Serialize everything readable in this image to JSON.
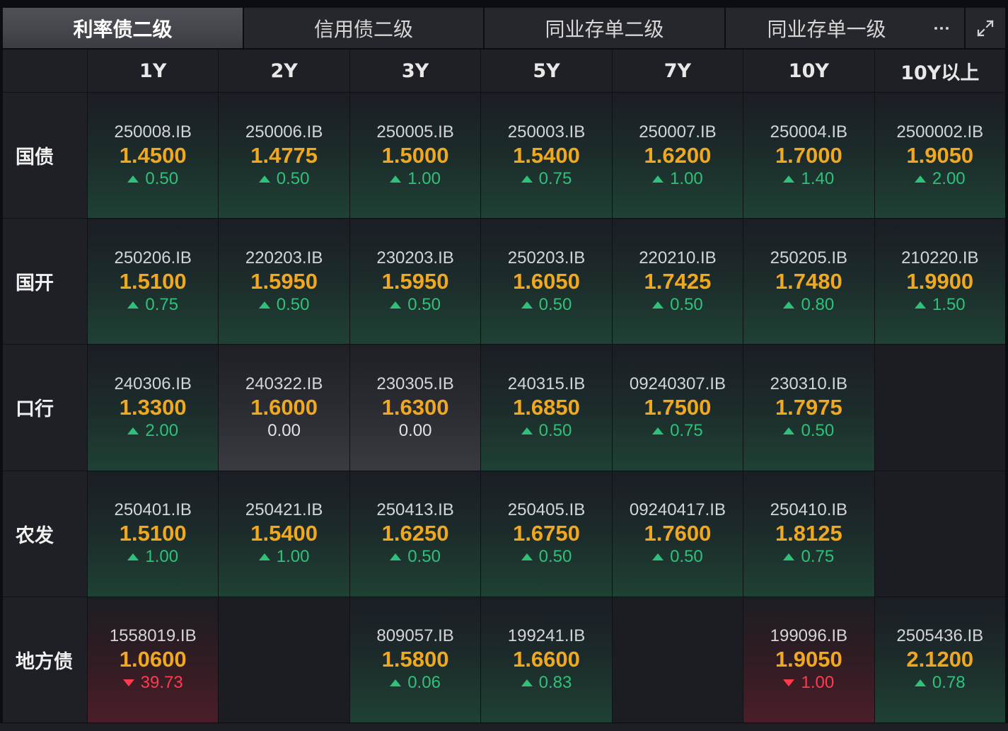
{
  "tabs": [
    {
      "label": "利率债二级",
      "active": true
    },
    {
      "label": "信用债二级",
      "active": false
    },
    {
      "label": "同业存单二级",
      "active": false
    },
    {
      "label": "同业存单一级",
      "active": false
    }
  ],
  "toolbar_icons": {
    "more": "more-icon",
    "expand": "expand-icon"
  },
  "columns": [
    "1Y",
    "2Y",
    "3Y",
    "5Y",
    "7Y",
    "10Y",
    "10Y以上"
  ],
  "rows": [
    {
      "label": "国债",
      "cells": [
        {
          "code": "250008.IB",
          "yield": "1.4500",
          "change": "0.50",
          "direction": "up"
        },
        {
          "code": "250006.IB",
          "yield": "1.4775",
          "change": "0.50",
          "direction": "up"
        },
        {
          "code": "250005.IB",
          "yield": "1.5000",
          "change": "1.00",
          "direction": "up"
        },
        {
          "code": "250003.IB",
          "yield": "1.5400",
          "change": "0.75",
          "direction": "up"
        },
        {
          "code": "250007.IB",
          "yield": "1.6200",
          "change": "1.00",
          "direction": "up"
        },
        {
          "code": "250004.IB",
          "yield": "1.7000",
          "change": "1.40",
          "direction": "up"
        },
        {
          "code": "2500002.IB",
          "yield": "1.9050",
          "change": "2.00",
          "direction": "up"
        }
      ]
    },
    {
      "label": "国开",
      "cells": [
        {
          "code": "250206.IB",
          "yield": "1.5100",
          "change": "0.75",
          "direction": "up"
        },
        {
          "code": "220203.IB",
          "yield": "1.5950",
          "change": "0.50",
          "direction": "up"
        },
        {
          "code": "230203.IB",
          "yield": "1.5950",
          "change": "0.50",
          "direction": "up"
        },
        {
          "code": "250203.IB",
          "yield": "1.6050",
          "change": "0.50",
          "direction": "up"
        },
        {
          "code": "220210.IB",
          "yield": "1.7425",
          "change": "0.50",
          "direction": "up"
        },
        {
          "code": "250205.IB",
          "yield": "1.7480",
          "change": "0.80",
          "direction": "up"
        },
        {
          "code": "210220.IB",
          "yield": "1.9900",
          "change": "1.50",
          "direction": "up"
        }
      ]
    },
    {
      "label": "口行",
      "cells": [
        {
          "code": "240306.IB",
          "yield": "1.3300",
          "change": "2.00",
          "direction": "up"
        },
        {
          "code": "240322.IB",
          "yield": "1.6000",
          "change": "0.00",
          "direction": "flat"
        },
        {
          "code": "230305.IB",
          "yield": "1.6300",
          "change": "0.00",
          "direction": "flat"
        },
        {
          "code": "240315.IB",
          "yield": "1.6850",
          "change": "0.50",
          "direction": "up"
        },
        {
          "code": "09240307.IB",
          "yield": "1.7500",
          "change": "0.75",
          "direction": "up"
        },
        {
          "code": "230310.IB",
          "yield": "1.7975",
          "change": "0.50",
          "direction": "up"
        },
        null
      ]
    },
    {
      "label": "农发",
      "cells": [
        {
          "code": "250401.IB",
          "yield": "1.5100",
          "change": "1.00",
          "direction": "up"
        },
        {
          "code": "250421.IB",
          "yield": "1.5400",
          "change": "1.00",
          "direction": "up"
        },
        {
          "code": "250413.IB",
          "yield": "1.6250",
          "change": "0.50",
          "direction": "up"
        },
        {
          "code": "250405.IB",
          "yield": "1.6750",
          "change": "0.50",
          "direction": "up"
        },
        {
          "code": "09240417.IB",
          "yield": "1.7600",
          "change": "0.50",
          "direction": "up"
        },
        {
          "code": "250410.IB",
          "yield": "1.8125",
          "change": "0.75",
          "direction": "up"
        },
        null
      ]
    },
    {
      "label": "地方债",
      "cells": [
        {
          "code": "1558019.IB",
          "yield": "1.0600",
          "change": "39.73",
          "direction": "down"
        },
        null,
        {
          "code": "809057.IB",
          "yield": "1.5800",
          "change": "0.06",
          "direction": "up"
        },
        {
          "code": "199241.IB",
          "yield": "1.6600",
          "change": "0.83",
          "direction": "up"
        },
        null,
        {
          "code": "199096.IB",
          "yield": "1.9050",
          "change": "1.00",
          "direction": "down"
        },
        {
          "code": "2505436.IB",
          "yield": "2.1200",
          "change": "0.78",
          "direction": "up"
        }
      ]
    }
  ],
  "colors": {
    "yield": "#f2a81d",
    "up": "#2fc07a",
    "down": "#ff3b4f",
    "flat": "#e2e2e2",
    "cell_up_tint": "#1f4134",
    "cell_flat_tint": "#3a3b41",
    "cell_down_tint": "#4b1e28",
    "active_tab_bg": "#46474d"
  }
}
